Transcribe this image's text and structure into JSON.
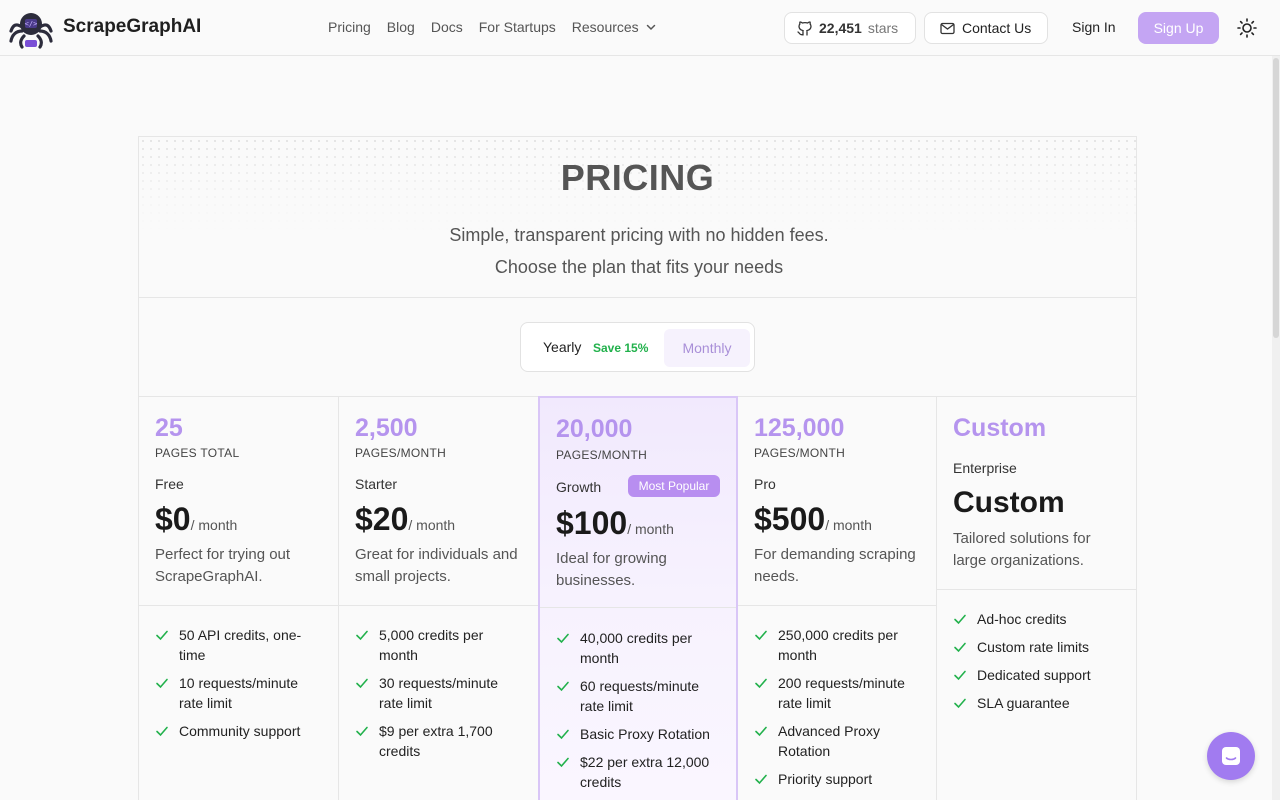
{
  "nav": {
    "brand": "ScrapeGraphAI",
    "links": [
      "Pricing",
      "Blog",
      "Docs",
      "For Startups"
    ],
    "resources_label": "Resources",
    "stars_count": "22,451",
    "stars_label": "stars",
    "contact_label": "Contact Us",
    "signin_label": "Sign In",
    "signup_label": "Sign Up"
  },
  "hero": {
    "title": "PRICING",
    "subtitle": "Simple, transparent pricing with no hidden fees. Choose the plan that fits your needs"
  },
  "billing_toggle": {
    "yearly_label": "Yearly",
    "save_label": "Save 15%",
    "monthly_label": "Monthly",
    "selected": "Monthly"
  },
  "plans": [
    {
      "count": "25",
      "unit": "PAGES TOTAL",
      "name": "Free",
      "price": "$0",
      "per": "/ month",
      "desc": "Perfect for trying out ScrapeGraphAI.",
      "features": [
        "50 API credits, one-time",
        "10 requests/minute rate limit",
        "Community support"
      ]
    },
    {
      "count": "2,500",
      "unit": "PAGES/MONTH",
      "name": "Starter",
      "price": "$20",
      "per": "/ month",
      "desc": "Great for individuals and small projects.",
      "features": [
        "5,000 credits per month",
        "30 requests/minute rate limit",
        "$9 per extra 1,700 credits"
      ]
    },
    {
      "count": "20,000",
      "unit": "PAGES/MONTH",
      "name": "Growth",
      "badge": "Most Popular",
      "price": "$100",
      "per": "/ month",
      "desc": "Ideal for growing businesses.",
      "features": [
        "40,000 credits per month",
        "60 requests/minute rate limit",
        "Basic Proxy Rotation",
        "$22 per extra 12,000 credits"
      ]
    },
    {
      "count": "125,000",
      "unit": "PAGES/MONTH",
      "name": "Pro",
      "price": "$500",
      "per": "/ month",
      "desc": "For demanding scraping needs.",
      "features": [
        "250,000 credits per month",
        "200 requests/minute rate limit",
        "Advanced Proxy Rotation",
        "Priority support"
      ]
    },
    {
      "count": "Custom",
      "name": "Enterprise",
      "price": "Custom",
      "desc": "Tailored solutions for large organizations.",
      "features": [
        "Ad-hoc credits",
        "Custom rate limits",
        "Dedicated support",
        "SLA guarantee"
      ]
    }
  ],
  "colors": {
    "accent": "#b594ee",
    "signup_bg": "#c4a5f3",
    "save_green": "#22b14c",
    "check_green": "#22b14c",
    "chat_bg": "#a17bf0"
  }
}
